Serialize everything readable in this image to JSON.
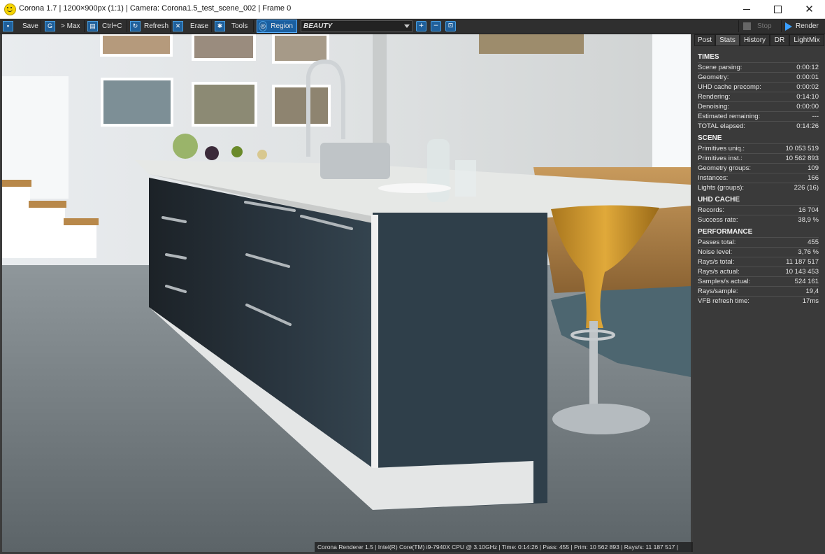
{
  "window": {
    "title": "Corona 1.7 | 1200×900px (1:1) | Camera: Corona1.5_test_scene_002 | Frame 0"
  },
  "toolbar": {
    "save": "Save",
    "max": "> Max",
    "copy": "Ctrl+C",
    "refresh": "Refresh",
    "erase": "Erase",
    "tools": "Tools",
    "region": "Region",
    "channel": "BEAUTY",
    "stop": "Stop",
    "render": "Render"
  },
  "tabs": [
    "Post",
    "Stats",
    "History",
    "DR",
    "LightMix"
  ],
  "active_tab": "Stats",
  "stats": {
    "times": {
      "title": "TIMES",
      "rows": [
        {
          "k": "Scene parsing:",
          "v": "0:00:12"
        },
        {
          "k": "Geometry:",
          "v": "0:00:01"
        },
        {
          "k": "UHD cache precomp:",
          "v": "0:00:02"
        },
        {
          "k": "Rendering:",
          "v": "0:14:10"
        },
        {
          "k": "Denoising:",
          "v": "0:00:00"
        },
        {
          "k": "Estimated remaining:",
          "v": "---"
        },
        {
          "k": "TOTAL elapsed:",
          "v": "0:14:26"
        }
      ]
    },
    "scene": {
      "title": "SCENE",
      "rows": [
        {
          "k": "Primitives uniq.:",
          "v": "10 053 519"
        },
        {
          "k": "Primitives inst.:",
          "v": "10 562 893"
        },
        {
          "k": "Geometry groups:",
          "v": "109"
        },
        {
          "k": "Instances:",
          "v": "166"
        },
        {
          "k": "Lights (groups):",
          "v": "226 (16)"
        }
      ]
    },
    "uhd": {
      "title": "UHD CACHE",
      "rows": [
        {
          "k": "Records:",
          "v": "16 704"
        },
        {
          "k": "Success rate:",
          "v": "38,9 %"
        }
      ]
    },
    "performance": {
      "title": "PERFORMANCE",
      "rows": [
        {
          "k": "Passes total:",
          "v": "455"
        },
        {
          "k": "Noise level:",
          "v": "3,76 %"
        },
        {
          "k": "Rays/s total:",
          "v": "11 187 517"
        },
        {
          "k": "Rays/s actual:",
          "v": "10 143 453"
        },
        {
          "k": "Samples/s actual:",
          "v": "524 161"
        },
        {
          "k": "Rays/sample:",
          "v": "19,4"
        },
        {
          "k": "VFB refresh time:",
          "v": "17ms"
        }
      ]
    }
  },
  "status_line": "Corona Renderer 1.5 | Intel(R) Core(TM) i9-7940X CPU @ 3.10GHz | Time: 0:14:26 | Pass: 455 | Prim: 10 562 893 | Rays/s: 11 187 517 |",
  "colors": {
    "accent": "#1a5fa0",
    "panel": "#3a3a3a",
    "toolbar": "#2f2f2f"
  }
}
